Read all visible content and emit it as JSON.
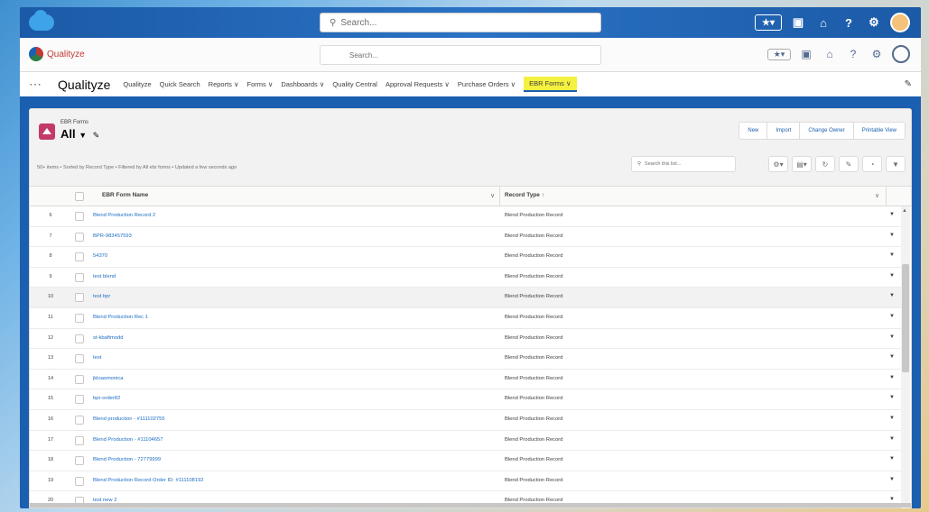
{
  "global_header": {
    "search_placeholder": "Search...",
    "icons": [
      "favorites-star-icon",
      "add-icon",
      "home-icon",
      "help-icon",
      "gear-icon",
      "avatar"
    ]
  },
  "app_header": {
    "logo_text": "Qualityze",
    "search_placeholder": "Search...",
    "icons": [
      "favorites-star-icon",
      "add-icon",
      "home-icon",
      "help-icon",
      "gear-icon",
      "robot-avatar"
    ]
  },
  "nav": {
    "app_name": "Qualityze",
    "items": [
      {
        "label": "Qualityze"
      },
      {
        "label": "Quick Search"
      },
      {
        "label": "Reports ∨"
      },
      {
        "label": "Forms ∨"
      },
      {
        "label": "Dashboards ∨"
      },
      {
        "label": "Quality Central"
      },
      {
        "label": "Approval Requests ∨"
      },
      {
        "label": "Purchase Orders ∨"
      },
      {
        "label": "EBR Forms ∨"
      }
    ]
  },
  "list": {
    "object_label": "EBR Forms",
    "list_view": "All",
    "meta": "50+ items • Sorted by Record Type • Filtered by All ebr forms • Updated a few seconds ago",
    "buttons": [
      "New",
      "Import",
      "Change Owner",
      "Printable View"
    ],
    "search_placeholder": "Search this list...",
    "columns": {
      "name": "EBR Form Name",
      "type": "Record Type ↑"
    },
    "rows": [
      {
        "n": "6",
        "name": "Blend Production Record 2",
        "type": "Blend Production Record"
      },
      {
        "n": "7",
        "name": "BPR-983457593",
        "type": "Blend Production Record"
      },
      {
        "n": "8",
        "name": "54370",
        "type": "Blend Production Record"
      },
      {
        "n": "9",
        "name": "test blend",
        "type": "Blend Production Record"
      },
      {
        "n": "10",
        "name": "test bpr",
        "type": "Blend Production Record"
      },
      {
        "n": "11",
        "name": "Blend Production Rec 1",
        "type": "Blend Production Record"
      },
      {
        "n": "12",
        "name": "st-kbaftmodd",
        "type": "Blend Production Record"
      },
      {
        "n": "13",
        "name": "test",
        "type": "Blend Production Record"
      },
      {
        "n": "14",
        "name": "jkloasmonica",
        "type": "Blend Production Record"
      },
      {
        "n": "15",
        "name": "bpr-order82",
        "type": "Blend Production Record"
      },
      {
        "n": "16",
        "name": "Blend production - #111102755",
        "type": "Blend Production Record"
      },
      {
        "n": "17",
        "name": "Blend Production - #11104657",
        "type": "Blend Production Record"
      },
      {
        "n": "18",
        "name": "Blend Production - 72779999",
        "type": "Blend Production Record"
      },
      {
        "n": "19",
        "name": "Blend Production Record Order ID: #111108192",
        "type": "Blend Production Record"
      },
      {
        "n": "20",
        "name": "test new 2",
        "type": "Blend Production Record"
      }
    ]
  }
}
